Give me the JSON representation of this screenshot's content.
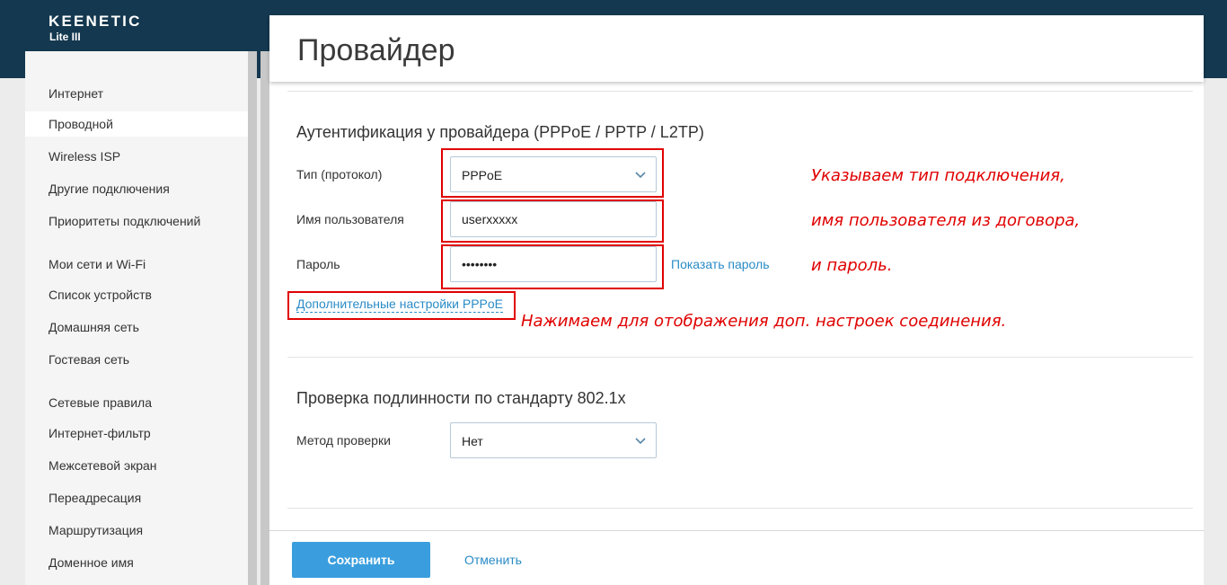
{
  "brand": {
    "name": "KEENETIC",
    "model": "Lite III"
  },
  "sidebar": {
    "items": [
      {
        "label": "Интернет"
      },
      {
        "label": "Проводной",
        "active": true
      },
      {
        "label": "Wireless ISP"
      },
      {
        "label": "Другие подключения"
      },
      {
        "label": "Приоритеты подключений"
      },
      {
        "label": "Мои сети и Wi-Fi"
      },
      {
        "label": "Список устройств"
      },
      {
        "label": "Домашняя сеть"
      },
      {
        "label": "Гостевая сеть"
      },
      {
        "label": "Сетевые правила"
      },
      {
        "label": "Интернет-фильтр"
      },
      {
        "label": "Межсетевой экран"
      },
      {
        "label": "Переадресация"
      },
      {
        "label": "Маршрутизация"
      },
      {
        "label": "Доменное имя"
      }
    ]
  },
  "page": {
    "title": "Провайдер"
  },
  "auth": {
    "title": "Аутентификация у провайдера (PPPoE / PPTP / L2TP)",
    "protocol": {
      "label": "Тип (протокол)",
      "value": "PPPoE",
      "icon": "chevron-down-icon"
    },
    "username": {
      "label": "Имя пользователя",
      "value": "userxxxxx"
    },
    "password": {
      "label": "Пароль",
      "value": "••••••••",
      "show_label": "Показать пароль"
    },
    "advanced_link": "Дополнительные настройки PPPoE"
  },
  "dot1x": {
    "title": "Проверка подлинности по стандарту 802.1x",
    "method": {
      "label": "Метод проверки",
      "value": "Нет",
      "icon": "chevron-down-icon"
    }
  },
  "annotations": {
    "line1": "Указываем тип подключения,",
    "line2": "имя пользователя из договора,",
    "line3": "и пароль.",
    "line4": "Нажимаем для отображения доп. настроек соединения."
  },
  "footer": {
    "save_label": "Сохранить",
    "cancel_label": "Отменить"
  },
  "colors": {
    "header": "#14384f",
    "accent": "#3a9ede",
    "link": "#2a8bc6",
    "annotation": "#e00000"
  }
}
